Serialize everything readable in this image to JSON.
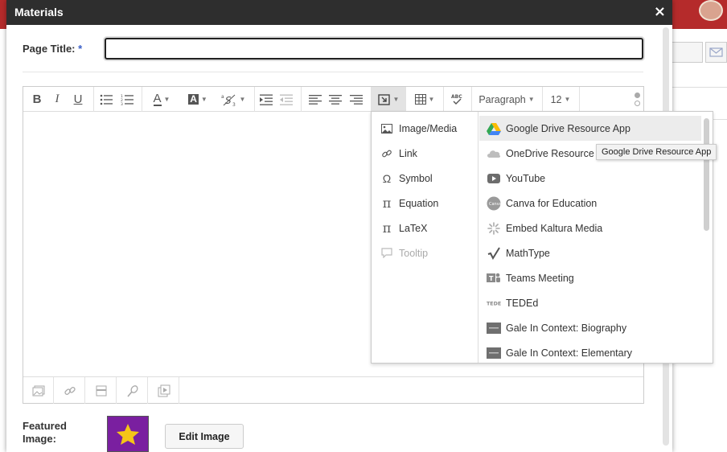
{
  "modal": {
    "title": "Materials",
    "close_icon": "×"
  },
  "form": {
    "page_title_label": "Page Title:",
    "required_mark": "*",
    "page_title_value": "",
    "featured_image_label_line1": "Featured",
    "featured_image_label_line2": "Image:",
    "edit_image_label": "Edit Image"
  },
  "toolbar": {
    "bold": "B",
    "italic": "I",
    "underline": "U",
    "text_color": "A",
    "highlight": "A",
    "format_select": "Paragraph",
    "font_size_select": "12"
  },
  "insert_menu": {
    "left_items": [
      {
        "label": "Image/Media",
        "icon": "image-icon",
        "disabled": false
      },
      {
        "label": "Link",
        "icon": "link-icon",
        "disabled": false
      },
      {
        "label": "Symbol",
        "icon": "omega-icon",
        "disabled": false
      },
      {
        "label": "Equation",
        "icon": "pi-icon",
        "disabled": false
      },
      {
        "label": "LaTeX",
        "icon": "pi-icon",
        "disabled": false
      },
      {
        "label": "Tooltip",
        "icon": "speech-bubble-icon",
        "disabled": true
      }
    ],
    "right_items": [
      {
        "label": "Google Drive Resource App",
        "icon": "google-drive-icon"
      },
      {
        "label": "OneDrive Resource App",
        "icon": "onedrive-icon"
      },
      {
        "label": "YouTube",
        "icon": "youtube-icon"
      },
      {
        "label": "Canva for Education",
        "icon": "canva-icon"
      },
      {
        "label": "Embed Kaltura Media",
        "icon": "kaltura-icon"
      },
      {
        "label": "MathType",
        "icon": "mathtype-icon"
      },
      {
        "label": "Teams Meeting",
        "icon": "teams-icon"
      },
      {
        "label": "TEDEd",
        "icon": "teded-icon"
      },
      {
        "label": "Gale In Context: Biography",
        "icon": "gale-icon"
      },
      {
        "label": "Gale In Context: Elementary",
        "icon": "gale-icon"
      }
    ]
  },
  "tooltip": {
    "text": "Google Drive Resource App"
  },
  "colors": {
    "header_bg": "#2e2e2e",
    "topbar_bg": "#b52b2b",
    "required": "#3a5fc8",
    "featured_bg": "#7a1fa0",
    "star": "#f5c518"
  }
}
